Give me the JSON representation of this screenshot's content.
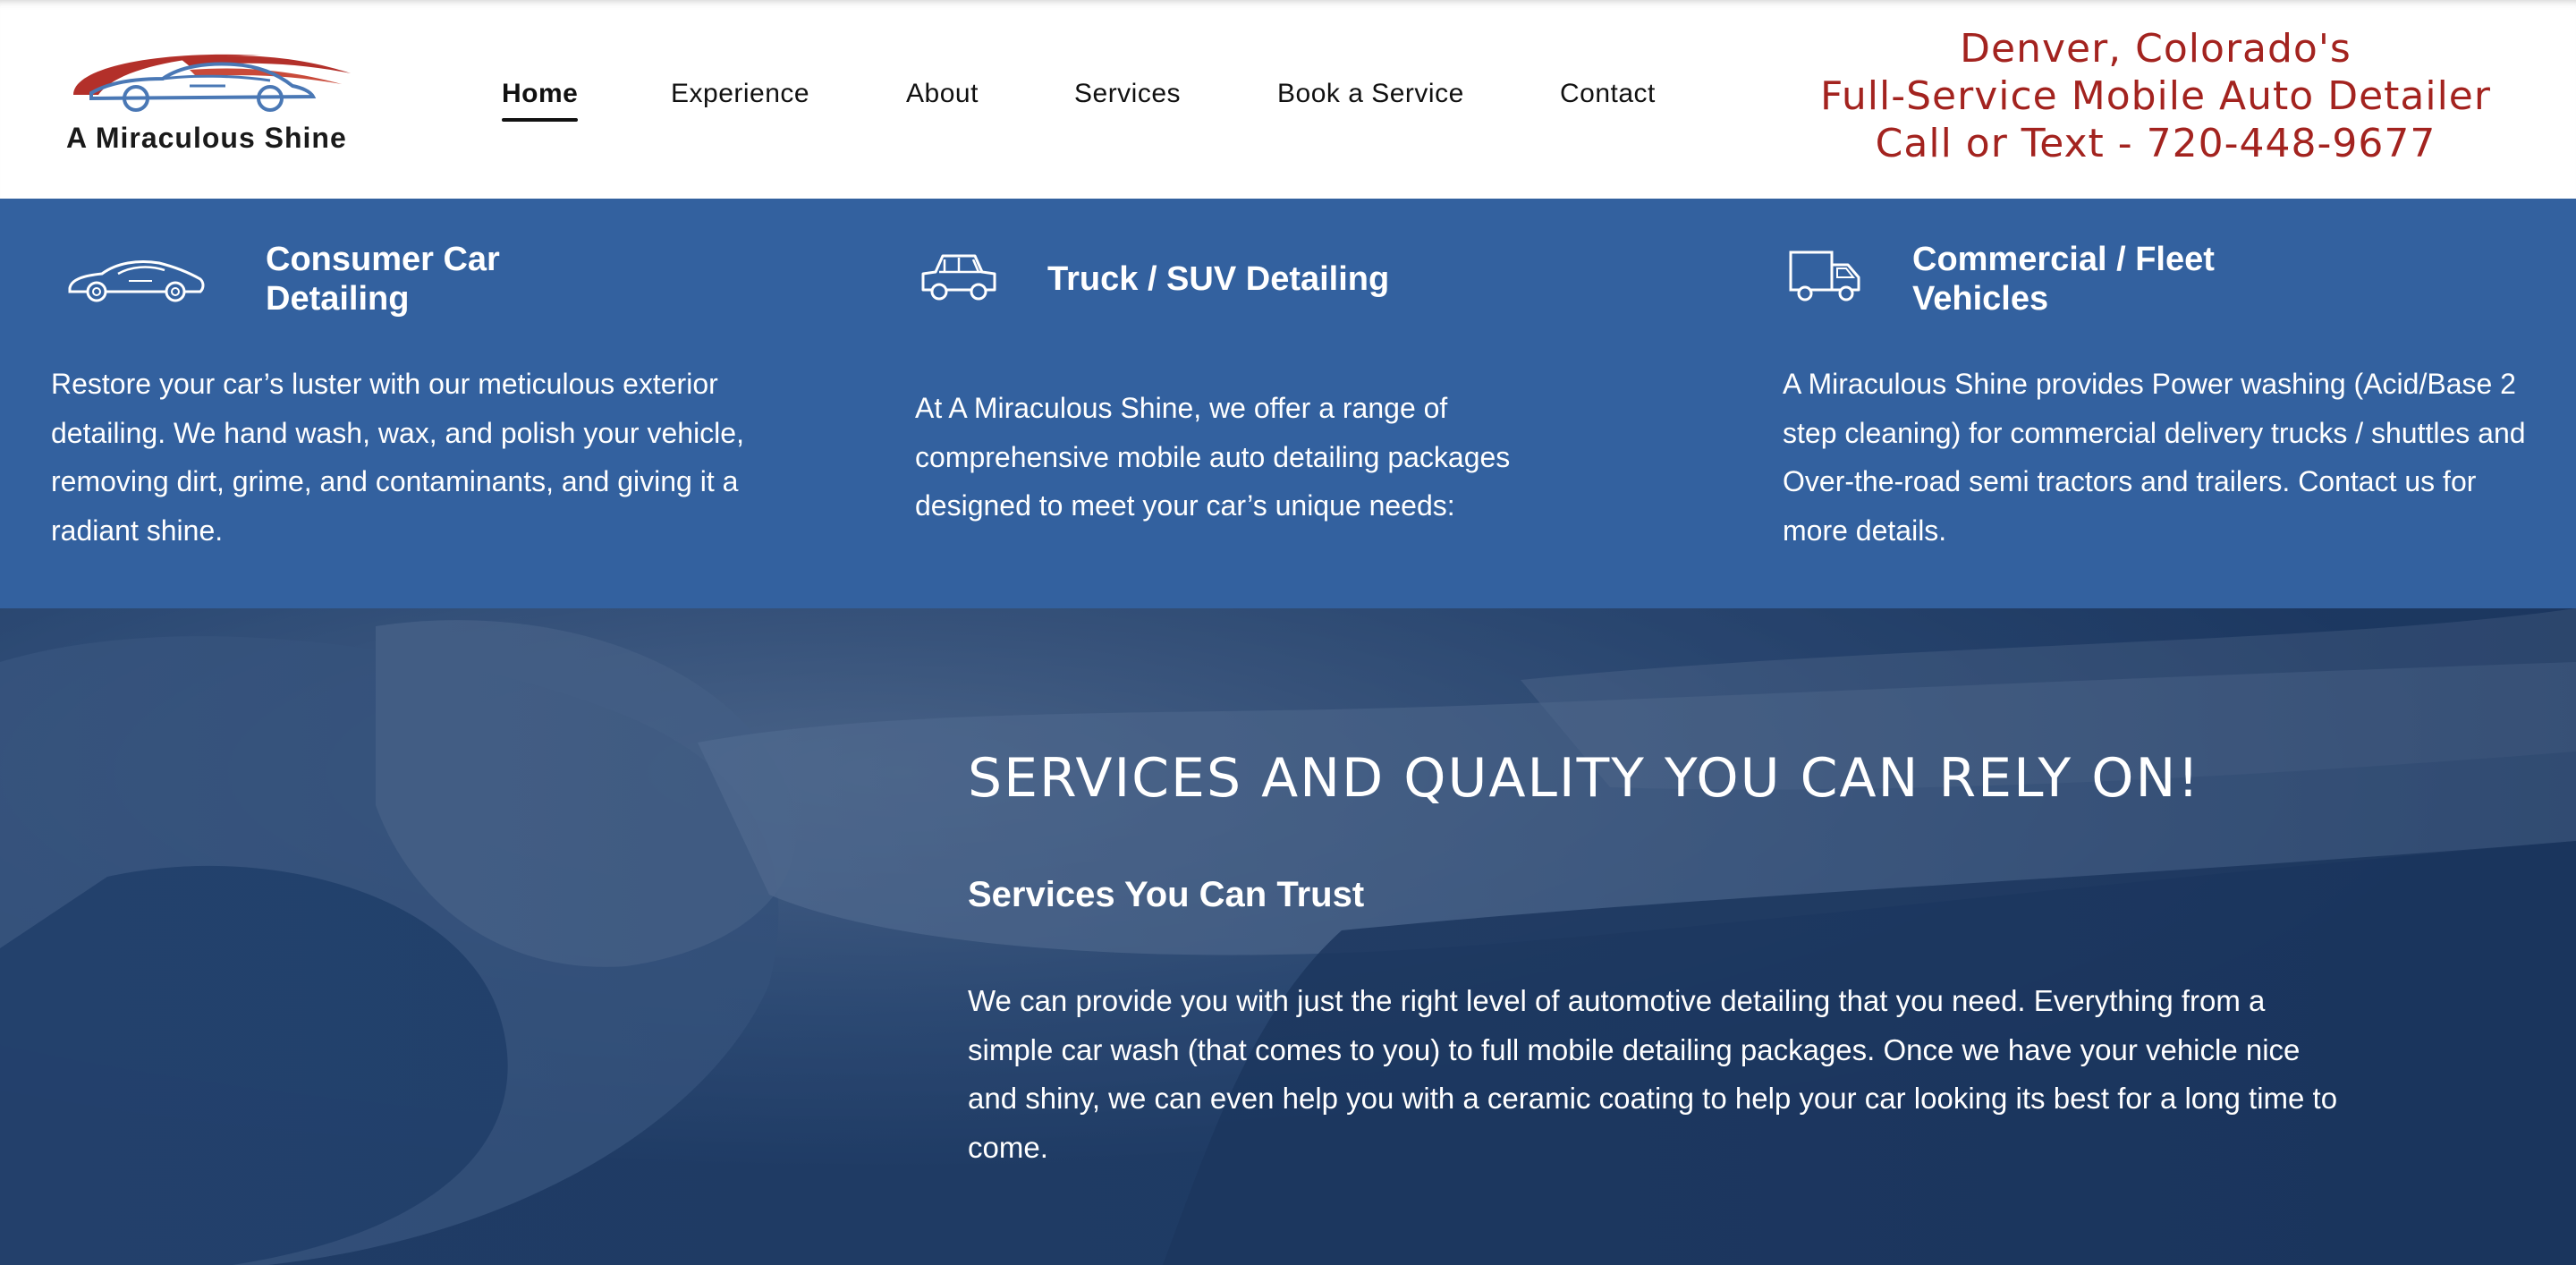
{
  "header": {
    "logo": {
      "text": "A Miraculous Shine",
      "icon": "car-swoosh-logo"
    },
    "nav": [
      {
        "label": "Home",
        "active": true
      },
      {
        "label": "Experience",
        "active": false
      },
      {
        "label": "About",
        "active": false
      },
      {
        "label": "Services",
        "active": false
      },
      {
        "label": "Book a Service",
        "active": false
      },
      {
        "label": "Contact",
        "active": false
      }
    ],
    "tagline": {
      "line1": "Denver, Colorado's",
      "line2": "Full-Service Mobile Auto Detailer",
      "line3": "Call or Text - 720-448-9677"
    }
  },
  "services": [
    {
      "icon": "sports-car-icon",
      "title_line1": "Consumer Car",
      "title_line2": "Detailing",
      "desc": "Restore your car’s luster with our meticulous exterior detailing. We hand wash, wax, and polish your vehicle, removing dirt, grime, and contaminants, and giving it a radiant shine."
    },
    {
      "icon": "suv-icon",
      "title_line1": "Truck / SUV Detailing",
      "title_line2": "",
      "desc": "At A Miraculous Shine, we offer a range of comprehensive mobile auto detailing packages designed to meet your car’s unique needs:"
    },
    {
      "icon": "truck-icon",
      "title_line1": "Commercial / Fleet",
      "title_line2": "Vehicles",
      "desc": "A Miraculous Shine provides Power washing (Acid/Base 2 step cleaning) for commercial delivery trucks / shuttles and Over-the-road semi tractors and trailers. Contact us for more details."
    }
  ],
  "hero": {
    "title": "SERVICES AND QUALITY YOU CAN RELY ON!",
    "subtitle": "Services You Can Trust",
    "body": "We can provide you with just the right level of automotive detailing that you need. Everything from a simple car wash (that comes to you) to full mobile detailing packages. Once we have your vehicle nice and shiny, we can even help you with a ceramic coating to help your car looking its best for a long time to come."
  },
  "colors": {
    "accent_red": "#a3231f",
    "band_blue": "#33619f",
    "hero_navy": "#213e66"
  }
}
